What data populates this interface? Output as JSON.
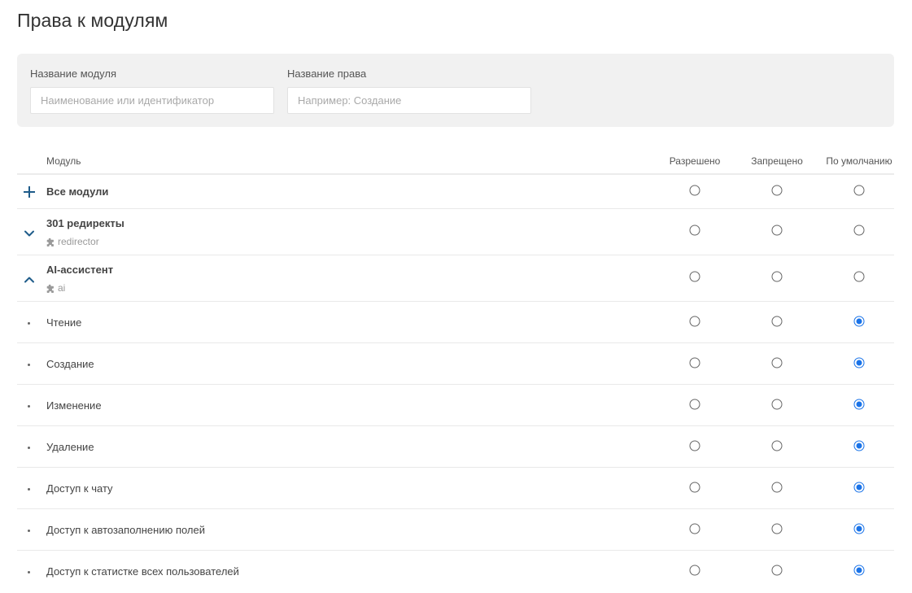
{
  "page": {
    "title": "Права к модулям"
  },
  "filters": {
    "module": {
      "label": "Название модуля",
      "placeholder": "Наименование или идентификатор",
      "value": ""
    },
    "right": {
      "label": "Название права",
      "placeholder": "Например: Создание",
      "value": ""
    }
  },
  "table": {
    "columns": {
      "module": "Модуль",
      "allowed": "Разрешено",
      "denied": "Запрещено",
      "default": "По умолчанию"
    },
    "rows": [
      {
        "kind": "all",
        "title": "Все модули",
        "toggle_icon": "plus-icon",
        "selected": ""
      },
      {
        "kind": "module",
        "title": "301 редиректы",
        "id": "redirector",
        "toggle_icon": "chevron-down-icon",
        "selected": ""
      },
      {
        "kind": "module",
        "title": "AI-ассистент",
        "id": "ai",
        "toggle_icon": "chevron-up-icon",
        "selected": ""
      },
      {
        "kind": "right",
        "title": "Чтение",
        "selected": "default"
      },
      {
        "kind": "right",
        "title": "Создание",
        "selected": "default"
      },
      {
        "kind": "right",
        "title": "Изменение",
        "selected": "default"
      },
      {
        "kind": "right",
        "title": "Удаление",
        "selected": "default"
      },
      {
        "kind": "right",
        "title": "Доступ к чату",
        "selected": "default"
      },
      {
        "kind": "right",
        "title": "Доступ к автозаполнению полей",
        "selected": "default"
      },
      {
        "kind": "right",
        "title": "Доступ к статистке всех пользователей",
        "selected": "default"
      }
    ]
  },
  "colors": {
    "accent": "#1a73e8",
    "toggle": "#1f5c8a",
    "panel_bg": "#f1f1f1"
  }
}
